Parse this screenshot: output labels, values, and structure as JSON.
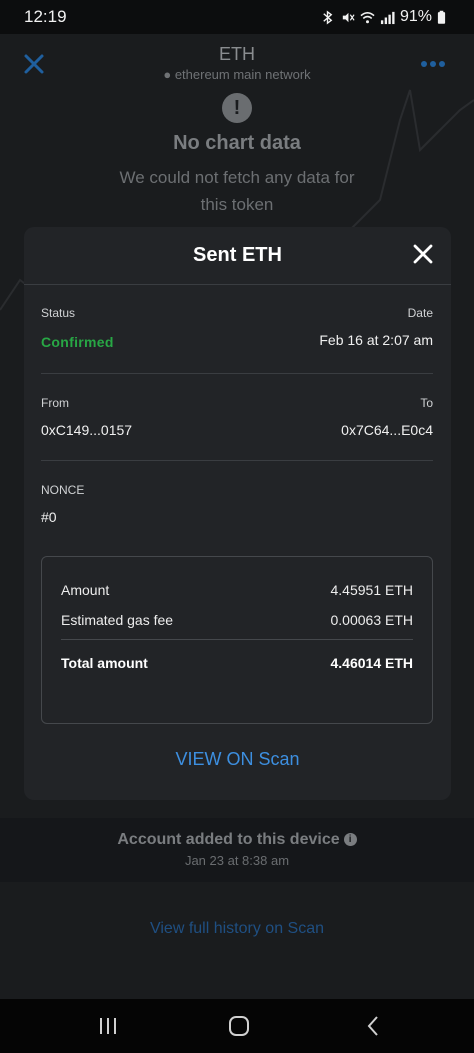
{
  "status_bar": {
    "time": "12:19",
    "battery": "91%"
  },
  "background": {
    "title": "ETH",
    "network": "ethereum main network",
    "chart_title": "No chart data",
    "chart_message": "We could not fetch any data for this token",
    "account_added": "Account added to this device",
    "account_added_date": "Jan 23 at 8:38 am",
    "full_history_link": "View full history on Scan"
  },
  "modal": {
    "title": "Sent ETH",
    "status_label": "Status",
    "status_value": "Confirmed",
    "date_label": "Date",
    "date_value": "Feb 16 at 2:07 am",
    "from_label": "From",
    "from_value": "0xC149...0157",
    "to_label": "To",
    "to_value": "0x7C64...E0c4",
    "nonce_label": "NONCE",
    "nonce_value": "#0",
    "summary": {
      "amount_label": "Amount",
      "amount_value": "4.45951 ETH",
      "gas_label": "Estimated gas fee",
      "gas_value": "0.00063 ETH",
      "total_label": "Total amount",
      "total_value": "4.46014 ETH"
    },
    "view_on_scan": "VIEW ON Scan"
  },
  "colors": {
    "accent": "#3d8fe0",
    "success": "#28a745",
    "modal_bg": "#222427"
  },
  "icons": {
    "close": "close-icon",
    "menu": "more-dots-icon",
    "warning": "exclamation-icon",
    "info": "info-icon",
    "nav_recent": "recent-apps-icon",
    "nav_home": "home-icon",
    "nav_back": "back-icon"
  }
}
